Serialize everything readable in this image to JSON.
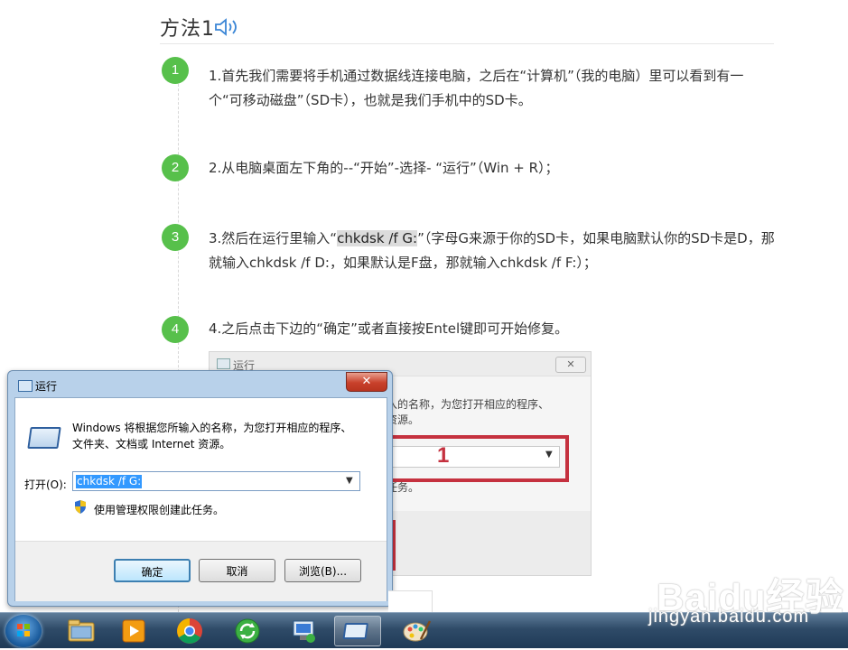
{
  "article": {
    "method_title": "方法1",
    "steps": [
      {
        "num": "1",
        "text": "1.首先我们需要将手机通过数据线连接电脑，之后在“计算机”（我的电脑）里可以看到有一个“可移动磁盘”（SD卡），也就是我们手机中的SD卡。"
      },
      {
        "num": "2",
        "text": "2.从电脑桌面左下角的--“开始”-选择- “运行”（Win + R）；"
      },
      {
        "num": "3",
        "text_before": "3.然后在运行里输入“",
        "highlight": "chkdsk /f G:",
        "text_after": "”（字母G来源于你的SD卡，如果电脑默认你的SD卡是D，那就输入chkdsk /f D:，如果默认是F盘，那就输入chkdsk /f F:）；"
      },
      {
        "num": "4",
        "text": "4.之后点击下边的“确定”或者直接按Entel键即可开始修复。"
      }
    ]
  },
  "background_shot": {
    "title": "运行",
    "close": "✕",
    "desc_line1": "入的名称，为您打开相应的程序、",
    "desc_line2": "资源。",
    "marker": "1",
    "task_fragment": "任务。"
  },
  "run_dialog": {
    "title": "运行",
    "close_glyph": "✕",
    "desc_line1": "Windows 将根据您所输入的名称，为您打开相应的程序、",
    "desc_line2": "文件夹、文档或 Internet 资源。",
    "open_label": "打开(O):",
    "input_value": "chkdsk /f G:",
    "admin_note": "使用管理权限创建此任务。",
    "ok_label": "确定",
    "cancel_label": "取消",
    "browse_label": "浏览(B)..."
  },
  "taskbar": {
    "items": [
      "start-orb",
      "explorer-icon",
      "media-player-icon",
      "chrome-icon",
      "green-refresh-icon",
      "network-app-icon",
      "run-window-icon",
      "paint-icon"
    ],
    "active_index": 6
  },
  "watermark": {
    "logo": "Baidu经验",
    "url": "jingyan.baidu.com"
  },
  "colors": {
    "step_green": "#57c04b",
    "highlight_red": "#c5313f",
    "selection_blue": "#3399ff"
  }
}
